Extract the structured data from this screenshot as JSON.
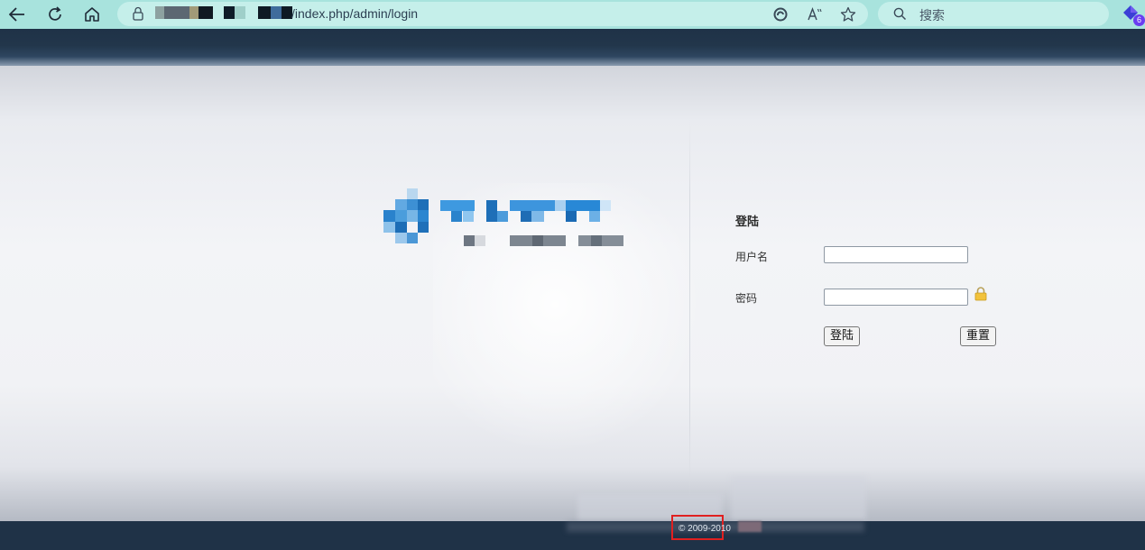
{
  "browser": {
    "url": "/index.php/admin/login",
    "search_placeholder": "搜索",
    "extension_badge": "6",
    "icons": {
      "back": "arrow-left-icon",
      "reload": "reload-icon",
      "home": "home-icon",
      "lock": "lock-icon",
      "edge": "edge-icon",
      "read_aloud": "read-aloud-icon",
      "favorite": "star-icon",
      "search": "search-icon",
      "extension": "extension-icon"
    },
    "colors": {
      "toolbar": "#a8e3dd",
      "address_bar": "#c5efea"
    }
  },
  "login": {
    "title": "登陆",
    "username_label": "用户名",
    "username_value": "",
    "password_label": "密码",
    "password_value": "",
    "submit_label": "登陆",
    "reset_label": "重置"
  },
  "footer": {
    "copyright": "© 2009-2010"
  },
  "colors": {
    "header": "#1f3247",
    "highlight": "#e02020",
    "logo_blue": "#2e8fd8"
  }
}
